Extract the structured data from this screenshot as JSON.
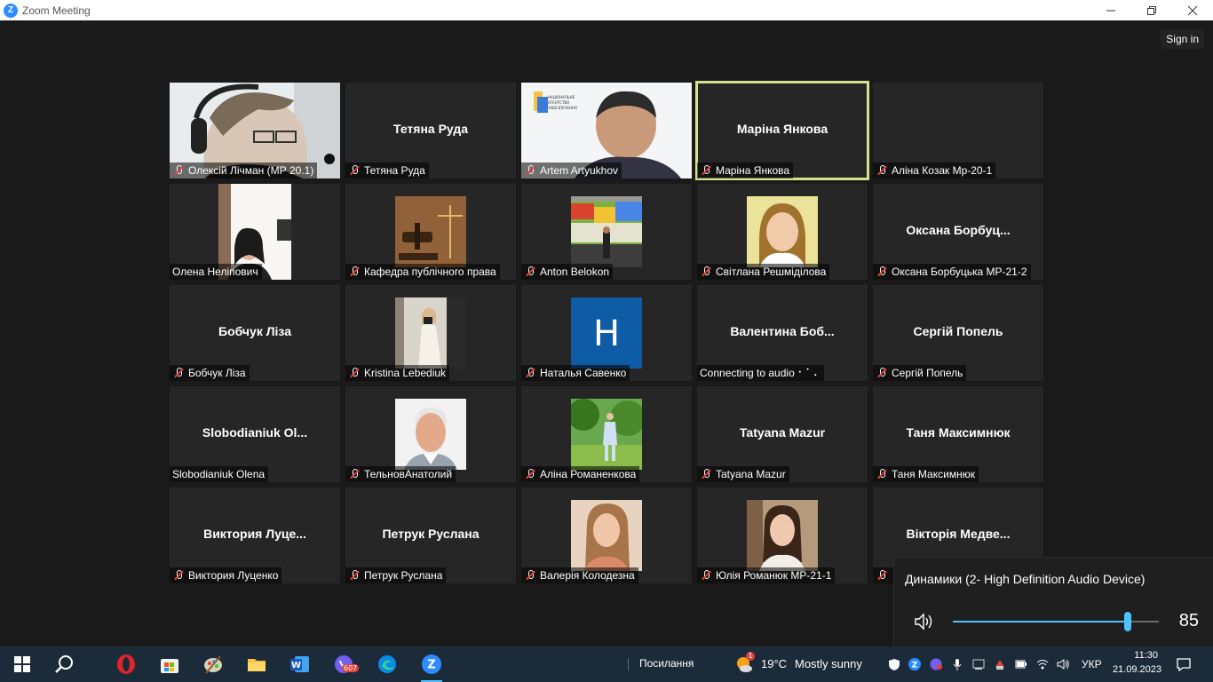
{
  "window": {
    "title": "Zoom Meeting",
    "app_icon": "Z"
  },
  "meeting": {
    "signin_label": "Sign in",
    "tiles": [
      {
        "big": "",
        "label": "Олексій Лічман (МР 20.1)",
        "muted": true,
        "media": "video-headset"
      },
      {
        "big": "Тетяна Руда",
        "label": "Тетяна Руда",
        "muted": true,
        "media": "none"
      },
      {
        "big": "",
        "label": "Artem Artyukhov",
        "muted": true,
        "media": "video-man"
      },
      {
        "big": "Маріна Янкова",
        "label": "Маріна Янкова",
        "muted": true,
        "media": "none",
        "active": true
      },
      {
        "big": "",
        "label": "Аліна Козак Мр-20-1",
        "muted": true,
        "media": "none"
      },
      {
        "big": "",
        "label": "Олена Неліпович",
        "muted": false,
        "media": "video-woman"
      },
      {
        "big": "",
        "label": "Кафедра публічного права",
        "muted": true,
        "media": "photo-gavel"
      },
      {
        "big": "",
        "label": "Anton Belokon",
        "muted": true,
        "media": "photo-graffiti"
      },
      {
        "big": "",
        "label": "Світлана Решмідiлова",
        "muted": true,
        "media": "photo-woman-yellow"
      },
      {
        "big": "Оксана  Борбуц...",
        "label": "Оксана Борбуцька МР-21-2",
        "muted": true,
        "media": "none"
      },
      {
        "big": "Бобчук Ліза",
        "label": "Бобчук Ліза",
        "muted": true,
        "media": "none"
      },
      {
        "big": "",
        "label": "Kristina Lebediuk",
        "muted": true,
        "media": "photo-mirror"
      },
      {
        "big": "",
        "label": "Наталья Савенко",
        "muted": true,
        "media": "letter-h"
      },
      {
        "big": "Валентина  Боб...",
        "label": "Connecting to audio ⠂⠁⠄",
        "muted": false,
        "media": "none"
      },
      {
        "big": "Сергій Попель",
        "label": "Сергій Попель",
        "muted": true,
        "media": "none"
      },
      {
        "big": "Slobodianiuk  Ol...",
        "label": "Slobodianiuk Olena",
        "muted": false,
        "media": "none"
      },
      {
        "big": "",
        "label": "ТельновАнатолий",
        "muted": true,
        "media": "photo-oldman"
      },
      {
        "big": "",
        "label": "Аліна Романенкова",
        "muted": true,
        "media": "photo-park"
      },
      {
        "big": "Tatyana Mazur",
        "label": "Tatyana Mazur",
        "muted": true,
        "media": "none"
      },
      {
        "big": "Таня Максимнюк",
        "label": "Таня Максимнюк",
        "muted": true,
        "media": "none"
      },
      {
        "big": "Виктория  Луце...",
        "label": "Виктория Луценко",
        "muted": true,
        "media": "none"
      },
      {
        "big": "Петрук Руслана",
        "label": "Петрук Руслана",
        "muted": true,
        "media": "none"
      },
      {
        "big": "",
        "label": "Валерія Колодезна",
        "muted": true,
        "media": "photo-girl"
      },
      {
        "big": "",
        "label": "Юлія Романюк МР-21-1",
        "muted": true,
        "media": "photo-girl2"
      },
      {
        "big": "Вікторія  Медве...",
        "label": "",
        "muted": true,
        "media": "none"
      }
    ],
    "letter_avatar": "H"
  },
  "volume_popup": {
    "device": "Динамики (2- High Definition Audio Device)",
    "level": "85",
    "level_fraction": 0.85
  },
  "taskbar": {
    "weather_badge": "1",
    "viber_badge": "607",
    "news_label": "Посилання",
    "temperature": "19°C",
    "weather": "Mostly sunny",
    "language": "УКР",
    "time": "11:30",
    "date": "21.09.2023",
    "colors": {
      "bg": "#1c2b3a",
      "accent": "#4cc2ff"
    }
  }
}
